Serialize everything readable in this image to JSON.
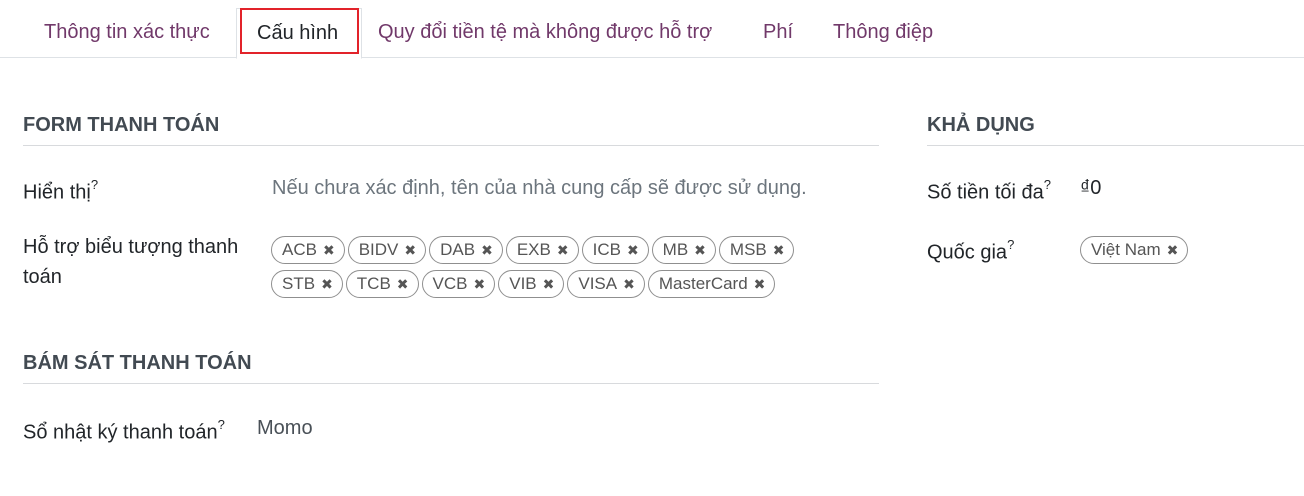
{
  "tabs": [
    {
      "label": "Thông tin xác thực"
    },
    {
      "label": "Cấu hình"
    },
    {
      "label": "Quy đổi tiền tệ mà không được hỗ trợ"
    },
    {
      "label": "Phí"
    },
    {
      "label": "Thông điệp"
    }
  ],
  "active_tab": "Cấu hình",
  "form_section": {
    "title": "FORM THANH TOÁN",
    "display_label": "Hiển thị",
    "display_help": "?",
    "display_placeholder": "Nếu chưa xác định, tên của nhà cung cấp sẽ được sử dụng.",
    "icons_label_line1": "Hỗ trợ biểu tượng thanh",
    "icons_label_line2": "toán",
    "icons": [
      "ACB",
      "BIDV",
      "DAB",
      "EXB",
      "ICB",
      "MB",
      "MSB",
      "STB",
      "TCB",
      "VCB",
      "VIB",
      "VISA",
      "MasterCard"
    ],
    "remove_glyph": "✖"
  },
  "tracking_section": {
    "title": "BÁM SÁT THANH TOÁN",
    "journal_label": "Sổ nhật ký thanh toán",
    "journal_help": "?",
    "journal_value": "Momo"
  },
  "availability_section": {
    "title": "KHẢ DỤNG",
    "max_amount_label": "Số tiền tối đa",
    "max_amount_help": "?",
    "max_amount_value": "₫0",
    "country_label": "Quốc gia",
    "country_help": "?",
    "countries": [
      "Việt Nam"
    ]
  },
  "colors": {
    "tab_text": "#71396a",
    "highlight": "#e2232a"
  }
}
